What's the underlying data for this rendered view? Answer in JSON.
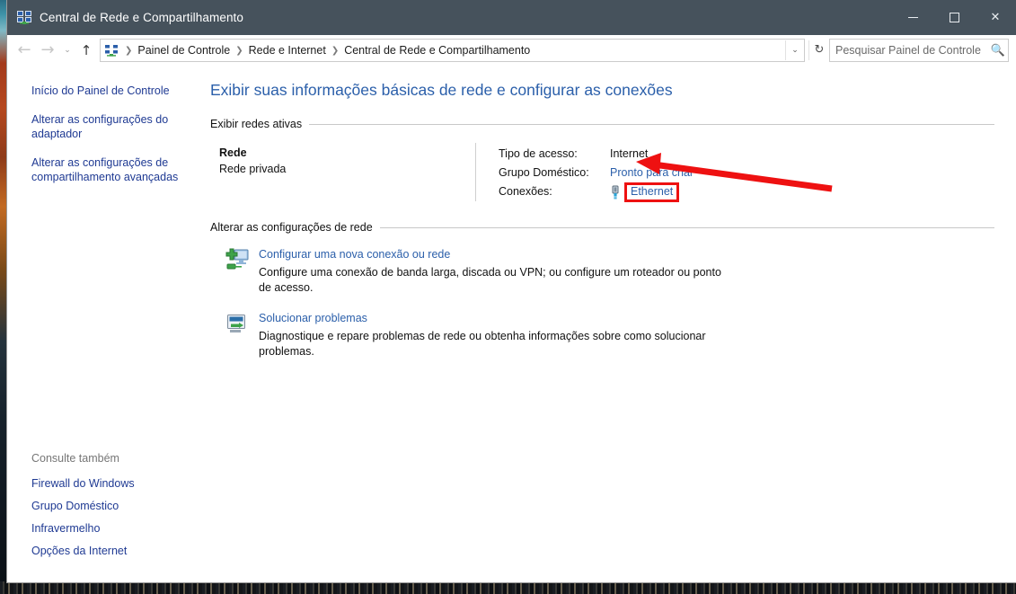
{
  "window": {
    "title": "Central de Rede e Compartilhamento",
    "icon": "network-sharing-icon",
    "controls": {
      "minimize": "minimize-button",
      "maximize": "maximize-button",
      "close": "close-button"
    },
    "titlebar_color": "#46525c"
  },
  "navbar": {
    "back": "←",
    "forward": "→",
    "history_chevron": "⌄",
    "up": "↑",
    "breadcrumbs": [
      "Painel de Controle",
      "Rede e Internet",
      "Central de Rede e Compartilhamento"
    ],
    "separator": "❯",
    "address_chevron": "⌄",
    "refresh": "↻"
  },
  "search": {
    "placeholder": "Pesquisar Painel de Controle",
    "value": "",
    "icon": "search-icon"
  },
  "sidebar": {
    "links": [
      "Início do Painel de Controle",
      "Alterar as configurações do adaptador",
      "Alterar as configurações de compartilhamento avançadas"
    ],
    "see_also_title": "Consulte também",
    "see_also_links": [
      "Firewall do Windows",
      "Grupo Doméstico",
      "Infravermelho",
      "Opções da Internet"
    ]
  },
  "main": {
    "heading": "Exibir suas informações básicas de rede e configurar as conexões",
    "section_active": "Exibir redes ativas",
    "section_change": "Alterar as configurações de rede",
    "active_network": {
      "name": "Rede",
      "type": "Rede privada",
      "details": [
        {
          "label": "Tipo de acesso:",
          "value": "Internet",
          "is_link": false
        },
        {
          "label": "Grupo Doméstico:",
          "value": "Pronto para criar",
          "is_link": true
        },
        {
          "label": "Conexões:",
          "value": "Ethernet",
          "is_link": true,
          "highlighted": true,
          "icon": "ethernet-plug-icon"
        }
      ]
    },
    "tasks": [
      {
        "icon": "new-connection-icon",
        "title": "Configurar uma nova conexão ou rede",
        "description": "Configure uma conexão de banda larga, discada ou VPN; ou configure um roteador ou ponto de acesso."
      },
      {
        "icon": "troubleshoot-icon",
        "title": "Solucionar problemas",
        "description": "Diagnostique e repare problemas de rede ou obtenha informações sobre como solucionar problemas."
      }
    ]
  },
  "annotation": {
    "highlight_color": "#ee1111",
    "arrow_color": "#ee1111",
    "target": "Ethernet"
  },
  "colors": {
    "link": "#2b5faa",
    "sidebar_link": "#1f3a93",
    "heading": "#2b5faa",
    "text": "#111111",
    "muted": "#767676"
  }
}
